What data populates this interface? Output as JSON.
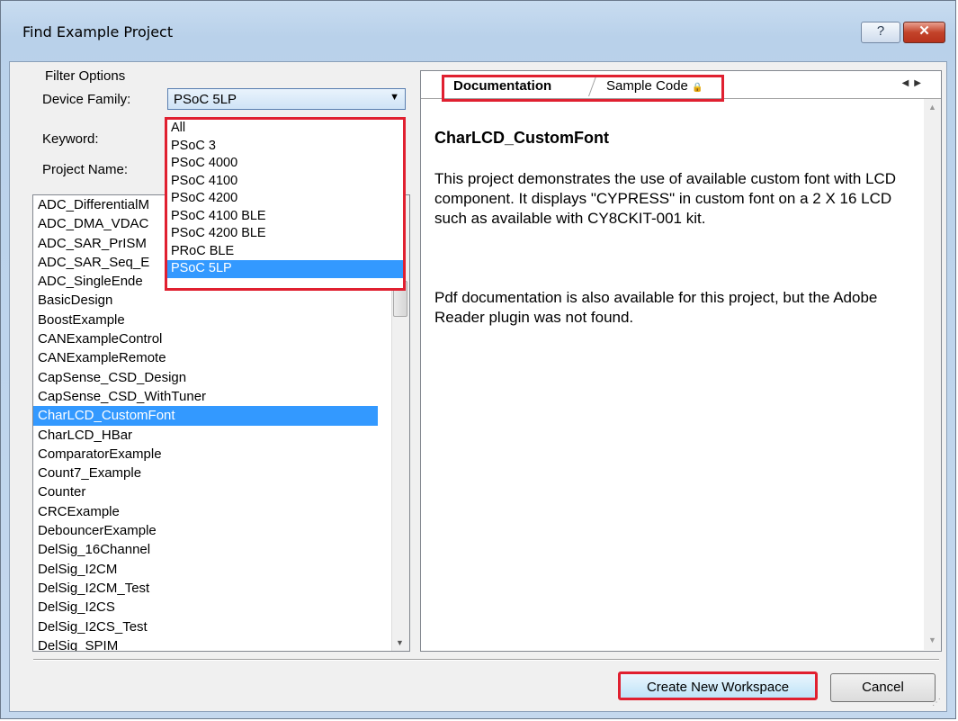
{
  "window": {
    "title": "Find Example Project",
    "help_label": "?",
    "close_label": "✕"
  },
  "filter": {
    "group_label": "Filter Options",
    "device_family_label": "Device Family:",
    "device_family_value": "PSoC 5LP",
    "keyword_label": "Keyword:",
    "project_name_label": "Project Name:",
    "dropdown_options": [
      "All",
      "PSoC 3",
      "PSoC 4000",
      "PSoC 4100",
      "PSoC 4200",
      "PSoC 4100 BLE",
      "PSoC 4200 BLE",
      "PRoC BLE",
      "PSoC 5LP"
    ],
    "dropdown_selected": "PSoC 5LP"
  },
  "projects": {
    "items": [
      "ADC_DifferentialM",
      "ADC_DMA_VDAC",
      "ADC_SAR_PrISM",
      "ADC_SAR_Seq_E",
      "ADC_SingleEnde",
      "BasicDesign",
      "BoostExample",
      "CANExampleControl",
      "CANExampleRemote",
      "CapSense_CSD_Design",
      "CapSense_CSD_WithTuner",
      "CharLCD_CustomFont",
      "CharLCD_HBar",
      "ComparatorExample",
      "Count7_Example",
      "Counter",
      "CRCExample",
      "DebouncerExample",
      "DelSig_16Channel",
      "DelSig_I2CM",
      "DelSig_I2CM_Test",
      "DelSig_I2CS",
      "DelSig_I2CS_Test",
      "DelSig_SPIM"
    ],
    "selected": "CharLCD_CustomFont"
  },
  "doc": {
    "tab_documentation": "Documentation",
    "tab_sample_code": "Sample Code",
    "title": "CharLCD_CustomFont",
    "paragraph1": "This project demonstrates the use of available custom font with LCD component. It displays \"CYPRESS\" in custom font on a 2 X 16 LCD such as available with CY8CKIT-001 kit.",
    "paragraph2": "Pdf documentation is also available for this project, but the Adobe Reader plugin was not found."
  },
  "buttons": {
    "create": "Create New Workspace",
    "cancel": "Cancel"
  },
  "colors": {
    "highlight": "#3399ff",
    "annotation_red": "#e02030"
  }
}
